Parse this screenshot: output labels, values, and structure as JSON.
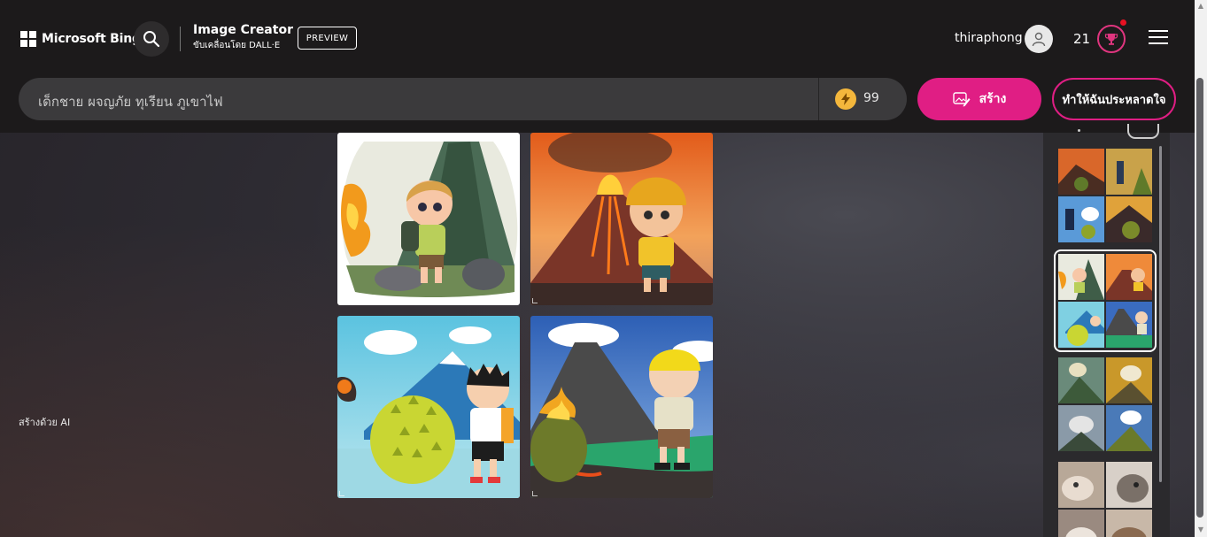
{
  "header": {
    "brand": "Microsoft Bing",
    "product_title": "Image Creator",
    "product_subtitle": "ขับเคลื่อนโดย DALL·E",
    "preview_badge": "PREVIEW",
    "username": "thiraphong",
    "reward_count": "21"
  },
  "prompt": {
    "value": "เด็กชาย ผจญภัย ทุเรียน ภูเขาไฟ",
    "boost_count": "99",
    "create_label": "สร้าง",
    "surprise_label": "ทำให้ฉันประหลาดใจ"
  },
  "footer_note": "สร้างด้วย AI",
  "icons": {
    "logo": "microsoft-logo",
    "search": "search-icon",
    "avatar": "user-icon",
    "rewards": "trophy-icon",
    "menu": "hamburger-icon",
    "boost": "lightning-icon",
    "create": "image-edit-icon"
  },
  "colors": {
    "accent": "#e01e84",
    "header_bg": "#1c1a1b",
    "boost": "#f4b73c"
  }
}
